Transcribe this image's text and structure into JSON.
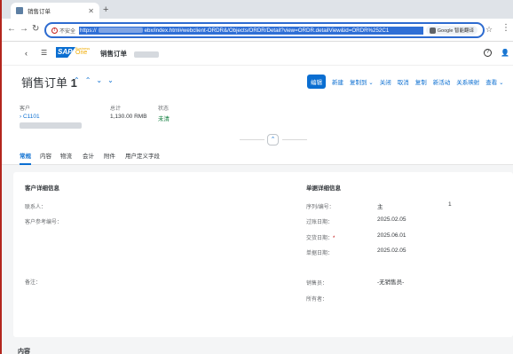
{
  "browser": {
    "tab_title": "销售订单",
    "new_tab": "+",
    "insecure_label": "不安全",
    "url_prefix": "https://",
    "url_rest": "ebx/index.html#webclient-ORDR&/Objects/ORDR/Detail?view=ORDR.detailView&id=ORDR%252C1",
    "translate_label": "Google 智能翻译"
  },
  "shell": {
    "title": "销售订单",
    "logo_text": "SAP",
    "logo_sub1": "Business",
    "logo_sub2": "One"
  },
  "header": {
    "title": "销售订单",
    "number": "1",
    "actions": {
      "edit": "编辑",
      "new": "新建",
      "copy_to": "复制到",
      "close": "关闭",
      "cancel": "取消",
      "duplicate": "复制",
      "new_activity": "新活动",
      "relationship_map": "关系映射",
      "view": "查看"
    },
    "customer_label": "客户",
    "customer_value": "C1101",
    "total_label": "总计",
    "total_value": "1,130.00 RMB",
    "status_label": "状态",
    "status_value": "未清"
  },
  "tabs": [
    "常规",
    "内容",
    "物流",
    "会计",
    "附件",
    "用户定义字段"
  ],
  "general": {
    "customer_section": "客户详细信息",
    "contact_label": "联系人：",
    "customer_ref_label": "客户参考编号：",
    "remarks_label": "备注：",
    "doc_section": "单据详细信息",
    "series_label": "序列/编号：",
    "series_value": "主",
    "series_number": "1",
    "posting_date_label": "过账日期：",
    "posting_date_value": "2025.02.05",
    "delivery_date_label": "交货日期：",
    "delivery_date_value": "2025.06.01",
    "document_date_label": "单据日期：",
    "document_date_value": "2025.02.05",
    "sales_employee_label": "销售员：",
    "sales_employee_value": "-无销售员-",
    "owner_label": "所有者："
  },
  "bottom_section_title": "内容"
}
